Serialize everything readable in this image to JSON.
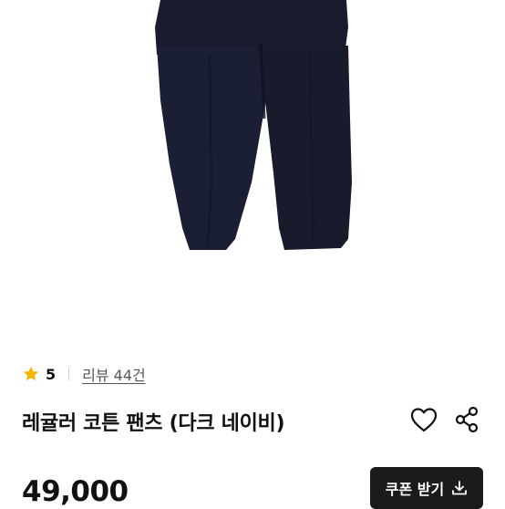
{
  "rating": {
    "score": "5",
    "reviews_label": "리뷰 44건"
  },
  "product": {
    "title": "레귤러 코튼 팬츠 (다크 네이비)",
    "price": "49,000",
    "image_icon": "navy-pants-photo"
  },
  "actions": {
    "coupon_label": "쿠폰 받기",
    "wishlist_icon": "heart-icon",
    "share_icon": "share-icon",
    "download_icon": "download-icon"
  },
  "colors": {
    "star": "#F5B400",
    "pants": "#1a1f33",
    "button_bg": "#1a1a1a"
  }
}
